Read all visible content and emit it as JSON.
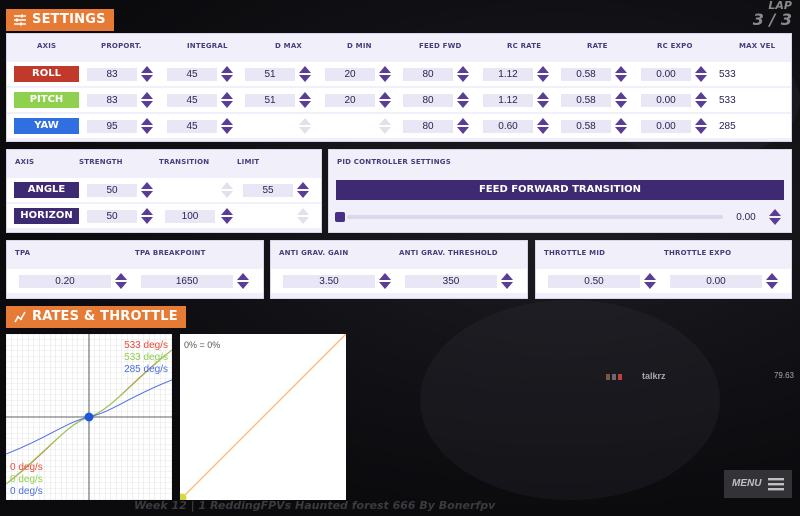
{
  "header": {
    "settings_title": "SETTINGS",
    "lap_label": "LAP",
    "lap_value": "3 / 3"
  },
  "pid_table": {
    "columns": [
      "AXIS",
      "PROPORT.",
      "INTEGRAL",
      "D MAX",
      "D MIN",
      "FEED FWD",
      "RC RATE",
      "RATE",
      "RC EXPO",
      "MAX VEL"
    ],
    "rows": [
      {
        "axis": "ROLL",
        "color": "#c0392b",
        "proport": "83",
        "integral": "45",
        "dmax": "51",
        "dmin": "20",
        "feedfwd": "80",
        "rcrate": "1.12",
        "rate": "0.58",
        "rcexpo": "0.00",
        "maxvel": "533"
      },
      {
        "axis": "PITCH",
        "color": "#8fd14f",
        "proport": "83",
        "integral": "45",
        "dmax": "51",
        "dmin": "20",
        "feedfwd": "80",
        "rcrate": "1.12",
        "rate": "0.58",
        "rcexpo": "0.00",
        "maxvel": "533"
      },
      {
        "axis": "YAW",
        "color": "#2f6fe0",
        "proport": "95",
        "integral": "45",
        "dmax": "",
        "dmin": "",
        "feedfwd": "80",
        "rcrate": "0.60",
        "rate": "0.58",
        "rcexpo": "0.00",
        "maxvel": "285"
      }
    ]
  },
  "modes": {
    "columns": [
      "AXIS",
      "STRENGTH",
      "TRANSITION",
      "LIMIT"
    ],
    "rows": [
      {
        "axis": "ANGLE",
        "strength": "50",
        "transition": "",
        "limit": "55"
      },
      {
        "axis": "HORIZON",
        "strength": "50",
        "transition": "100",
        "limit": ""
      }
    ]
  },
  "pid_controller": {
    "title": "PID CONTROLLER SETTINGS",
    "button": "FEED FORWARD TRANSITION",
    "slider_value": "0.00",
    "slider_fraction": 0
  },
  "tpa": {
    "tpa_label": "TPA",
    "tpa_value": "0.20",
    "breakpoint_label": "TPA BREAKPOINT",
    "breakpoint_value": "1650"
  },
  "anti_grav": {
    "gain_label": "ANTI GRAV. GAIN",
    "gain_value": "3.50",
    "threshold_label": "ANTI GRAV. THRESHOLD",
    "threshold_value": "350"
  },
  "throttle": {
    "mid_label": "THROTTLE MID",
    "mid_value": "0.50",
    "expo_label": "THROTTLE EXPO",
    "expo_value": "0.00"
  },
  "rates_header": "RATES & THROTTLE",
  "rates_chart": {
    "legend_top": [
      "533 deg/s",
      "533 deg/s",
      "285 deg/s"
    ],
    "legend_bottom": [
      "0 deg/s",
      "0 deg/s",
      "0 deg/s"
    ],
    "colors": [
      "#e74c3c",
      "#8fd14f",
      "#4a6fe0"
    ]
  },
  "throttle_chart": {
    "label": "0% = 0%",
    "color": "#f5c27a"
  },
  "leaderboard": {
    "name": "talkrz",
    "time": "79.63"
  },
  "footer": {
    "track_title": "Week 12 | 1 ReddingFPVs Haunted forest 666 By Bonerfpv",
    "menu_label": "MENU"
  }
}
